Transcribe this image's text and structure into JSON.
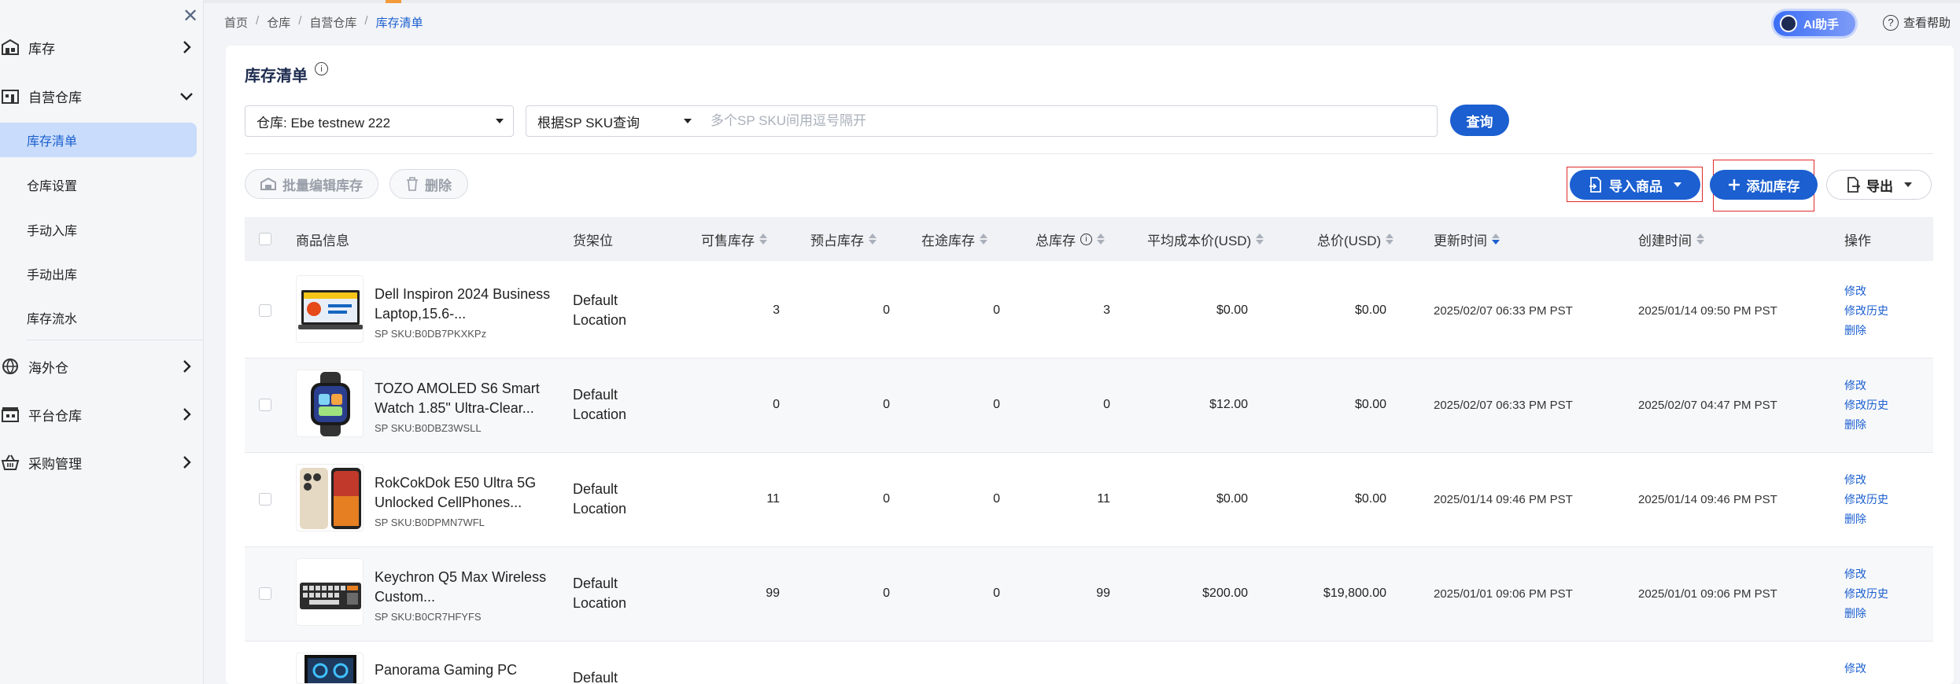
{
  "sidebar": {
    "close_icon": "close-icon",
    "groups": [
      {
        "label": "库存",
        "icon": "warehouse-icon"
      },
      {
        "label": "自营仓库",
        "icon": "building-icon"
      },
      {
        "label": "海外仓",
        "icon": "globe-warehouse-icon"
      },
      {
        "label": "平台仓库",
        "icon": "platform-warehouse-icon"
      },
      {
        "label": "采购管理",
        "icon": "basket-icon"
      }
    ],
    "sub_items": [
      {
        "label": "库存清单",
        "active": true
      },
      {
        "label": "仓库设置"
      },
      {
        "label": "手动入库"
      },
      {
        "label": "手动出库"
      },
      {
        "label": "库存流水"
      }
    ]
  },
  "breadcrumb": [
    "首页",
    "仓库",
    "自营仓库",
    "库存清单"
  ],
  "header": {
    "ai_label": "AI助手",
    "help_label": "查看帮助"
  },
  "page": {
    "title": "库存清单"
  },
  "filters": {
    "warehouse": "仓库: Ebe testnew 222",
    "query_mode": "根据SP SKU查询",
    "search_placeholder": "多个SP SKU间用逗号隔开",
    "query_button": "查询"
  },
  "toolbar": {
    "batch_edit": "批量编辑库存",
    "delete": "删除",
    "import": "导入商品",
    "add_stock": "添加库存",
    "export": "导出"
  },
  "table": {
    "columns": [
      "商品信息",
      "货架位",
      "可售库存",
      "预占库存",
      "在途库存",
      "总库存",
      "平均成本价(USD)",
      "总价(USD)",
      "更新时间",
      "创建时间",
      "操作"
    ],
    "rows": [
      {
        "name": "Dell Inspiron 2024 Business Laptop,15.6-...",
        "sku": "SP SKU:B0DB7PKXKPz",
        "location": "Default Location",
        "sellable": "3",
        "reserved": "0",
        "transit": "0",
        "total": "3",
        "avg_cost": "$0.00",
        "total_price": "$0.00",
        "updated": "2025/02/07 06:33 PM PST",
        "created": "2025/01/14 09:50 PM PST"
      },
      {
        "name": "TOZO AMOLED S6 Smart Watch 1.85\" Ultra-Clear...",
        "sku": "SP SKU:B0DBZ3WSLL",
        "location": "Default Location",
        "sellable": "0",
        "reserved": "0",
        "transit": "0",
        "total": "0",
        "avg_cost": "$12.00",
        "total_price": "$0.00",
        "updated": "2025/02/07 06:33 PM PST",
        "created": "2025/02/07 04:47 PM PST"
      },
      {
        "name": "RokCokDok E50 Ultra 5G Unlocked CellPhones...",
        "sku": "SP SKU:B0DPMN7WFL",
        "location": "Default Location",
        "sellable": "11",
        "reserved": "0",
        "transit": "0",
        "total": "11",
        "avg_cost": "$0.00",
        "total_price": "$0.00",
        "updated": "2025/01/14 09:46 PM PST",
        "created": "2025/01/14 09:46 PM PST"
      },
      {
        "name": "Keychron Q5 Max Wireless Custom...",
        "sku": "SP SKU:B0CR7HFYFS",
        "location": "Default Location",
        "sellable": "99",
        "reserved": "0",
        "transit": "0",
        "total": "99",
        "avg_cost": "$200.00",
        "total_price": "$19,800.00",
        "updated": "2025/01/01 09:06 PM PST",
        "created": "2025/01/01 09:06 PM PST"
      },
      {
        "name": "Panorama Gaming PC",
        "sku": "",
        "location": "Default",
        "sellable": "",
        "reserved": "",
        "transit": "",
        "total": "",
        "avg_cost": "",
        "total_price": "",
        "updated": "",
        "created": ""
      }
    ],
    "actions": [
      "修改",
      "修改历史",
      "删除"
    ]
  }
}
